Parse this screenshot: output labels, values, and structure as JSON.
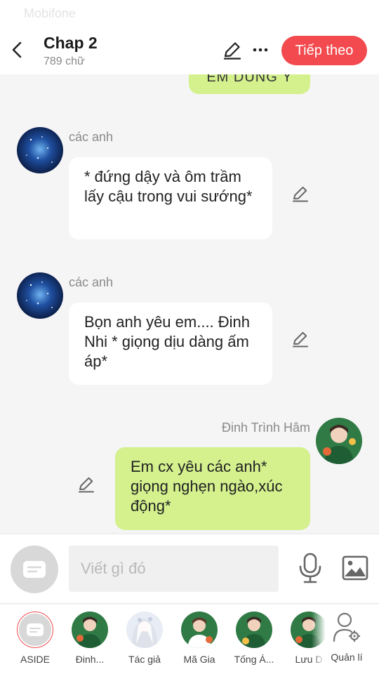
{
  "status_bar": {
    "carrier": "Mobifone"
  },
  "header": {
    "title": "Chap 2",
    "word_count": "789 chữ",
    "next_label": "Tiếp theo",
    "accent_color": "#f24a4e"
  },
  "chat": {
    "messages": [
      {
        "side": "right",
        "text": "EM DÙNG Ý"
      },
      {
        "side": "left",
        "sender": "các anh",
        "text": "* đứng dậy và ôm trầm lấy cậu trong vui sướng*"
      },
      {
        "side": "left",
        "sender": "các anh",
        "text": "Bọn anh yêu em.... Đinh Nhi * giọng dịu dàng ấm áp*"
      },
      {
        "side": "right",
        "sender": "Đinh Trình Hâm",
        "text": "Em cx yêu các anh* giọng nghẹn ngào,xúc động*"
      }
    ],
    "green_bubble_color": "#d4f18e"
  },
  "input": {
    "placeholder": "Viết gì đó"
  },
  "characters": [
    {
      "label": "ASIDE",
      "icon": "chat-bubble-icon",
      "selected": true
    },
    {
      "label": "Đinh...",
      "icon": "character-avatar"
    },
    {
      "label": "Tác giả",
      "icon": "author-avatar"
    },
    {
      "label": "Mã Gia",
      "icon": "character-avatar"
    },
    {
      "label": "Tống Á...",
      "icon": "character-avatar"
    },
    {
      "label": "Lưu D",
      "icon": "character-avatar"
    }
  ],
  "manage": {
    "label": "Quản lí",
    "icon": "user-settings-icon"
  }
}
